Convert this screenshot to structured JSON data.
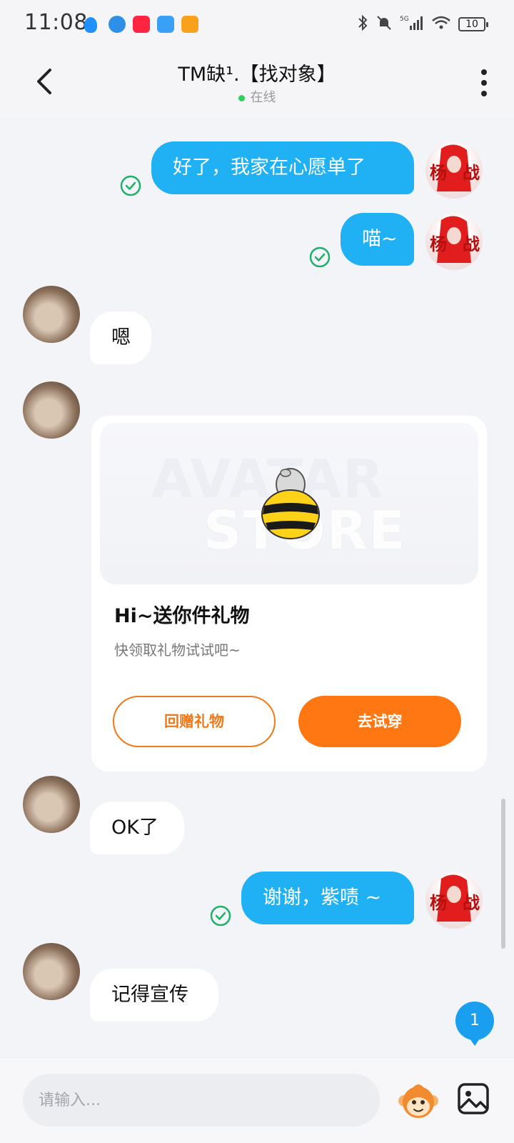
{
  "status_bar": {
    "time": "11:08",
    "network": "5G",
    "battery": "10"
  },
  "header": {
    "title": "TM缺¹.【找对象】",
    "status": "在线"
  },
  "messages": [
    {
      "from": "me",
      "text": "好了，我家在心愿单了"
    },
    {
      "from": "me",
      "text": "喵~"
    },
    {
      "from": "other",
      "text": "嗯"
    },
    {
      "from": "other",
      "type": "gift_card"
    },
    {
      "from": "other",
      "text": "OK了"
    },
    {
      "from": "me",
      "text": "谢谢，紫啧 ~"
    },
    {
      "from": "other",
      "text": "记得宣传"
    }
  ],
  "gift_card": {
    "watermark_line1": "AVATAR",
    "watermark_line2": "STORE",
    "title": "Hi~送你件礼物",
    "subtitle": "快领取礼物试试吧~",
    "secondary_button": "回赠礼物",
    "primary_button": "去试穿"
  },
  "unread_badge": "1",
  "input": {
    "placeholder": "请输入..."
  },
  "colors": {
    "my_bubble": "#20b1f5",
    "accent_orange": "#ff7712",
    "online_dot": "#2fcf5b"
  }
}
